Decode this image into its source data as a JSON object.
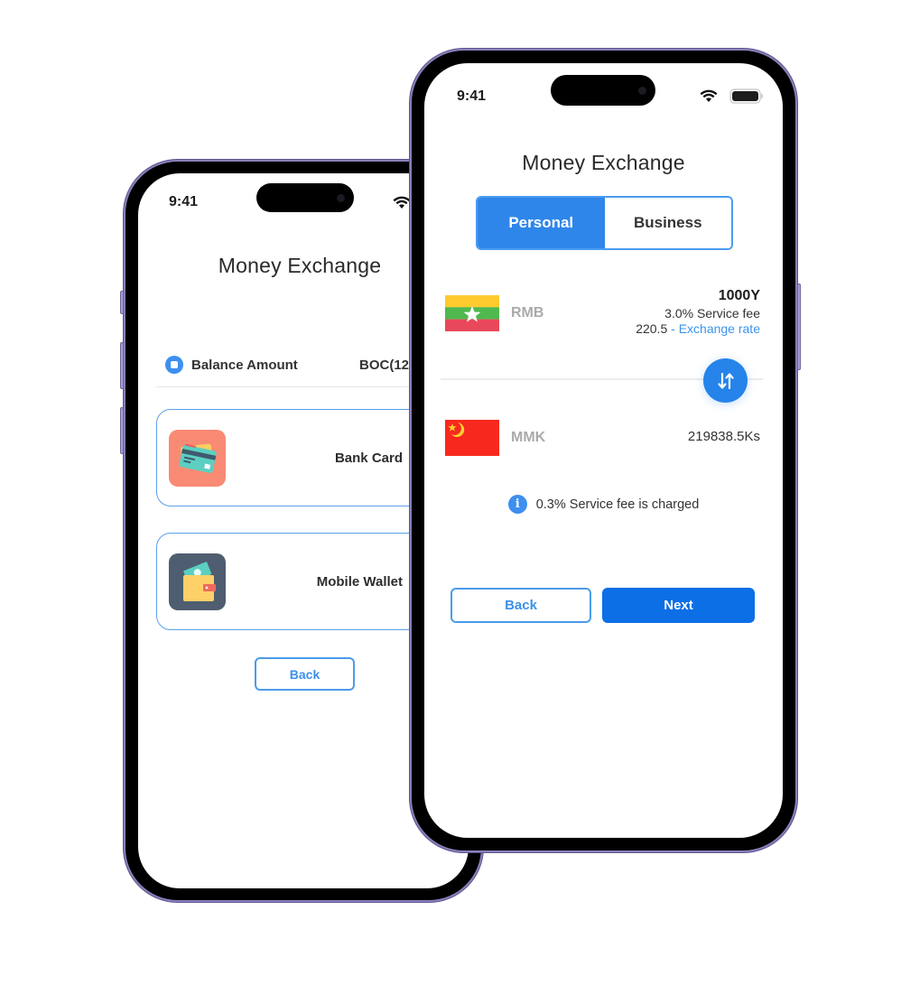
{
  "left_phone": {
    "status_bar": {
      "time": "9:41"
    },
    "title": "Money Exchange",
    "balance": {
      "label": "Balance Amount",
      "value": "BOC(12"
    },
    "methods": [
      {
        "label": "Bank Card",
        "icon": "bank-card-icon",
        "icon_bg": "#f98a74"
      },
      {
        "label": "Mobile Wallet",
        "icon": "mobile-wallet-icon",
        "icon_bg": "#4f5d70"
      }
    ],
    "back_label": "Back"
  },
  "right_phone": {
    "status_bar": {
      "time": "9:41"
    },
    "title": "Money Exchange",
    "tabs": [
      {
        "label": "Personal",
        "active": true
      },
      {
        "label": "Business",
        "active": false
      }
    ],
    "from": {
      "currency": "RMB",
      "flag": "myanmar-flag-icon",
      "amount": "1000Y",
      "service_fee": "3.0% Service fee",
      "rate_value": "220.5",
      "rate_separator": " - ",
      "rate_label": "Exchange rate"
    },
    "to": {
      "currency": "MMK",
      "flag": "china-flag-icon",
      "amount": "219838.5Ks"
    },
    "swap_icon": "swap-arrows-icon",
    "info": {
      "icon": "info-icon",
      "glyph": "i",
      "text": "0.3% Service fee is charged"
    },
    "back_label": "Back",
    "next_label": "Next"
  },
  "colors": {
    "primary": "#2f86ea",
    "button_solid": "#0c6fe6",
    "link": "#3b93ee",
    "card_border": "#5ba0ea",
    "frame_accent": "#8a7fb8"
  }
}
